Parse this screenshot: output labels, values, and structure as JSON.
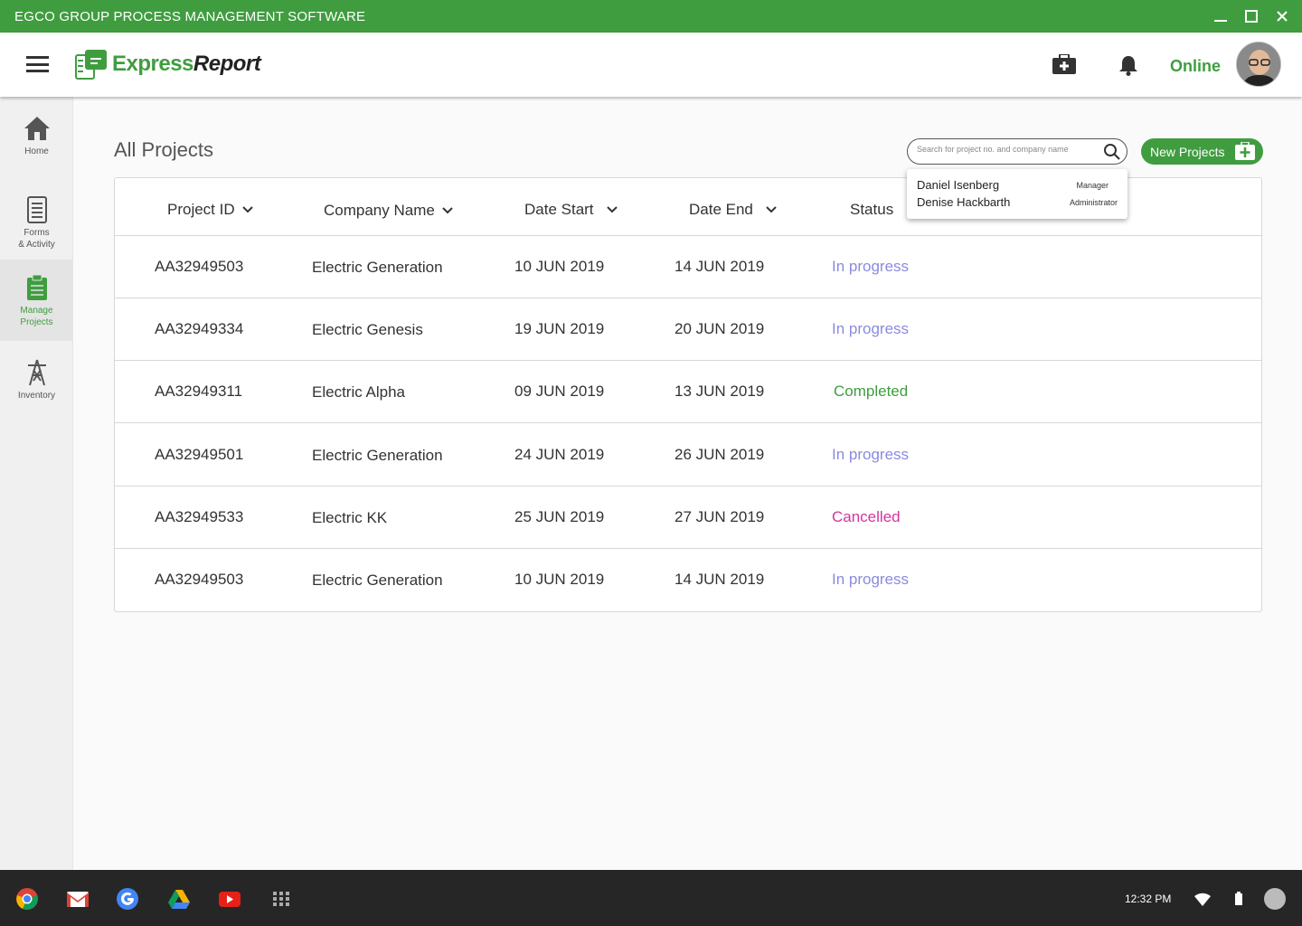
{
  "window": {
    "title": "EGCO GROUP PROCESS MANAGEMENT SOFTWARE",
    "accent_color": "#3f9d3f"
  },
  "header": {
    "logo_express": "Express",
    "logo_report": "Report",
    "status": "Online"
  },
  "sidebar": {
    "items": [
      {
        "label_line1": "Home",
        "label_line2": "",
        "icon": "home-icon",
        "active": false
      },
      {
        "label_line1": "Forms",
        "label_line2": "& Activity",
        "icon": "forms-icon",
        "active": false
      },
      {
        "label_line1": "Manage",
        "label_line2": "Projects",
        "icon": "clipboard-icon",
        "active": true
      },
      {
        "label_line1": "Inventory",
        "label_line2": "",
        "icon": "tower-icon",
        "active": false
      }
    ]
  },
  "main": {
    "title": "All Projects",
    "search_placeholder": "Search for project no. and company name",
    "new_button_label": "New Projects",
    "columns": [
      "Project ID",
      "Company Name",
      "Date Start",
      "Date End",
      "Status"
    ],
    "rows": [
      {
        "id": "AA32949503",
        "company": "Electric Generation",
        "start": "10 JUN 2019",
        "end": "14 JUN 2019",
        "status": "In progress",
        "status_type": "progress"
      },
      {
        "id": "AA32949334",
        "company": "Electric Genesis",
        "start": "19 JUN 2019",
        "end": "20 JUN 2019",
        "status": "In progress",
        "status_type": "progress"
      },
      {
        "id": "AA32949311",
        "company": "Electric Alpha",
        "start": "09 JUN 2019",
        "end": "13 JUN 2019",
        "status": "Completed",
        "status_type": "completed"
      },
      {
        "id": "AA32949501",
        "company": "Electric Generation",
        "start": "24 JUN 2019",
        "end": "26 JUN 2019",
        "status": "In progress",
        "status_type": "progress"
      },
      {
        "id": "AA32949533",
        "company": "Electric KK",
        "start": "25 JUN 2019",
        "end": "27 JUN 2019",
        "status": "Cancelled",
        "status_type": "cancelled"
      },
      {
        "id": "AA32949503",
        "company": "Electric Generation",
        "start": "10 JUN 2019",
        "end": "14 JUN 2019",
        "status": "In progress",
        "status_type": "progress"
      }
    ],
    "status_colors": {
      "progress": "#8a8ae0",
      "completed": "#3f9d3f",
      "cancelled": "#d4349f"
    }
  },
  "dropdown": {
    "items": [
      {
        "name": "Daniel Isenberg",
        "role": "Manager"
      },
      {
        "name": "Denise Hackbarth",
        "role": "Administrator"
      }
    ]
  },
  "taskbar": {
    "time": "12:32 PM",
    "apps": [
      "chrome-icon",
      "gmail-icon",
      "google-icon",
      "drive-icon",
      "youtube-icon",
      "apps-grid-icon"
    ]
  }
}
